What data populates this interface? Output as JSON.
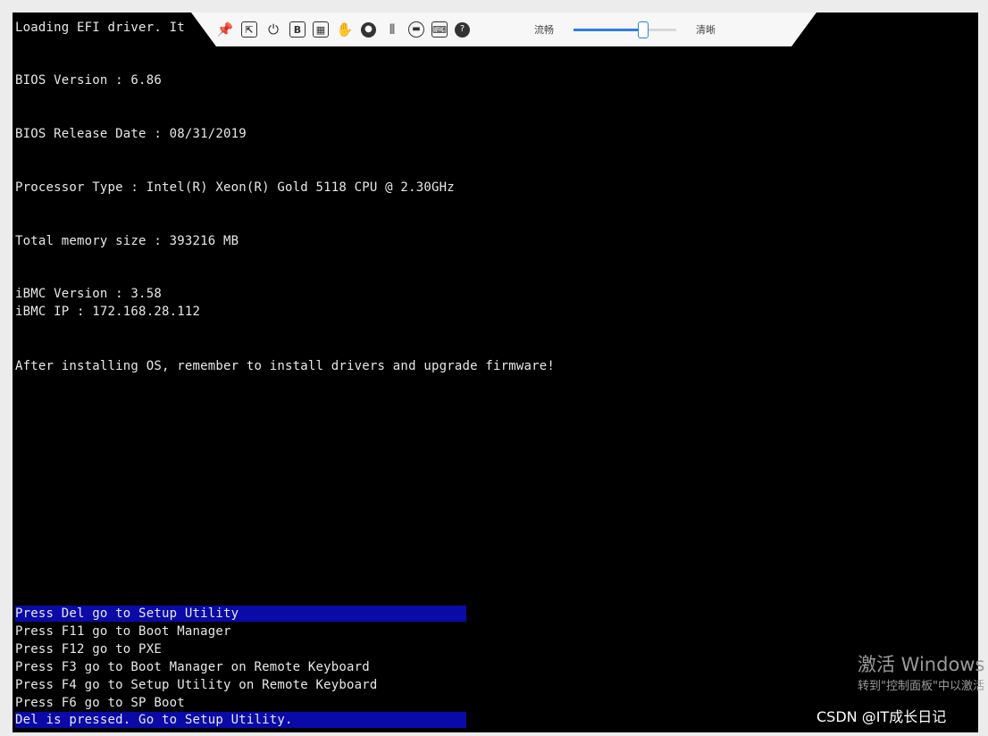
{
  "console": {
    "loading": "Loading EFI driver. It",
    "bios_version": "BIOS Version : 6.86",
    "bios_release_date": "BIOS Release Date : 08/31/2019",
    "processor": "Processor Type : Intel(R) Xeon(R) Gold 5118 CPU @ 2.30GHz",
    "memory": "Total memory size : 393216 MB",
    "ibmc_version": "iBMC Version : 3.58",
    "ibmc_ip": "iBMC IP : 172.168.28.112",
    "notice": "After installing OS, remember to install drivers and upgrade firmware!",
    "hotkeys": [
      "Press Del go to Setup Utility",
      "Press F11 go to Boot Manager",
      "Press F12 go to PXE",
      "Press F3 go to Boot Manager on Remote Keyboard",
      "Press F4 go to Setup Utility on Remote Keyboard",
      "Press F6 go to SP Boot"
    ],
    "status": "Del is pressed. Go to Setup Utility.",
    "highlight_color": "#0a0aa8"
  },
  "toolbar": {
    "icons": [
      "pin-icon",
      "fit-screen-icon",
      "power-icon",
      "b-icon",
      "grid-icon",
      "mouse-icon",
      "disc-icon",
      "device-icon",
      "record-icon",
      "keyboard-icon",
      "help-icon"
    ],
    "quality_left_label": "流畅",
    "quality_right_label": "清晰",
    "quality_level": 0.68,
    "accent_color": "#2f7fe0"
  },
  "watermark": {
    "line1": "激活 Windows",
    "line2": "转到\"控制面板\"中以激活"
  },
  "credit": "CSDN @IT成长日记"
}
